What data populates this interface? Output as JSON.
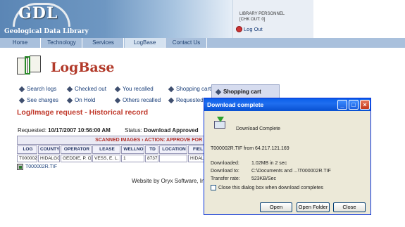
{
  "header": {
    "logo_title": "GDL",
    "logo_subtitle": "Geological Data Library",
    "user_role": "LIBRARY PERSONNEL",
    "user_chk": "[CHK OUT: 0]",
    "logout_label": "Log Out"
  },
  "nav": {
    "items": [
      {
        "label": "Home"
      },
      {
        "label": "Technology"
      },
      {
        "label": "Services"
      },
      {
        "label": "LogBase"
      },
      {
        "label": "Contact Us"
      }
    ],
    "active": "LogBase"
  },
  "page": {
    "title": "LogBase",
    "section_title": "Log/Image request - Historical record",
    "requested_label": "Requested:",
    "requested_value": "10/17/2007 10:56:00 AM",
    "status_label": "Status:",
    "status_value": "Download Approved"
  },
  "links": {
    "search_logs": "Search logs",
    "checked_out": "Checked out",
    "you_recalled": "You recalled",
    "shopping_cart": "Shopping cart",
    "shopping_cart_tab": "Shopping cart",
    "see_charges": "See charges",
    "on_hold": "On Hold",
    "others_recalled": "Others recalled",
    "requested": "Requested"
  },
  "table": {
    "heading": "SCANNED IMAGES › ACTION: APPROVE FOR",
    "columns": [
      "LOG",
      "COUNTY",
      "OPERATOR",
      "LEASE",
      "WELLNO",
      "TD",
      "LOCATION",
      "FIEL"
    ],
    "row": [
      "T000002",
      "HIDALGO",
      "GEDDIE, P. O.",
      "VESS, E. L.",
      "1",
      "8737",
      "",
      "HIDAL"
    ],
    "file_link": "T000002R.TIF"
  },
  "footer": {
    "text": "Website by Oryx Software, Inc."
  },
  "dialog": {
    "title": "Download complete",
    "heading": "Download Complete",
    "from_text": "T000002R.TIF from 64.217.121.169",
    "downloaded_label": "Downloaded:",
    "downloaded_value": "1.02MB in 2 sec",
    "download_to_label": "Download to:",
    "download_to_value": "C:\\Documents and ...\\T000002R.TIF",
    "rate_label": "Transfer rate:",
    "rate_value": "523KB/Sec",
    "close_checkbox_label": "Close this dialog box when download completes",
    "open_button": "Open",
    "open_folder_button": "Open Folder",
    "close_button": "Close"
  },
  "colors": {
    "accent_red": "#b23a2a",
    "nav_bg": "#a9c0dc",
    "link_blue": "#1a3f7a",
    "dialog_titlebar": "#0a5ee8"
  }
}
